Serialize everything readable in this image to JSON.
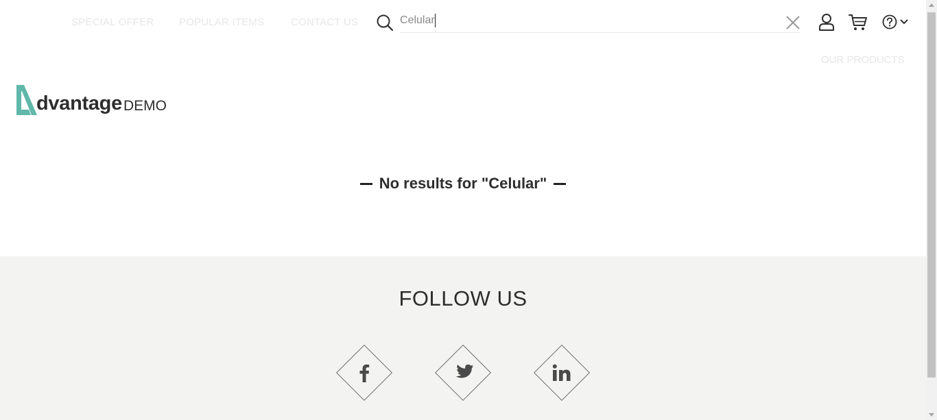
{
  "nav": {
    "special_offer": "SPECIAL OFFER",
    "popular_items": "POPULAR ITEMS",
    "contact_us": "CONTACT US",
    "our_products": "OUR PRODUCTS"
  },
  "search": {
    "value": "Celular",
    "icons": [
      "search-icon",
      "close-icon"
    ]
  },
  "header_icons": [
    "user-icon",
    "cart-icon",
    "help-icon",
    "chevron-down-icon"
  ],
  "logo": {
    "word": "dvantage",
    "suffix": "DEMO",
    "accent_color": "#5fb8aa"
  },
  "results": {
    "message": "No results for \"Celular\""
  },
  "footer": {
    "follow_title": "FOLLOW US",
    "social": [
      "facebook-icon",
      "twitter-icon",
      "linkedin-icon"
    ]
  },
  "colors": {
    "footer_bg": "#f3f3f1",
    "nav_faded": "#e7e7e7",
    "text": "#2d2d2d"
  }
}
